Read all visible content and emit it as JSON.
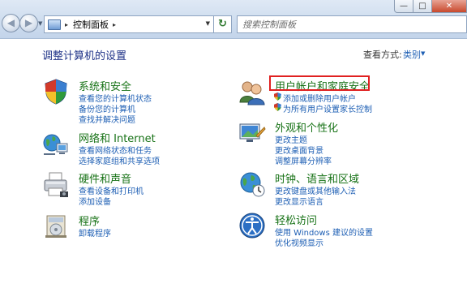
{
  "window": {
    "minimize_glyph": "—",
    "maximize_glyph": "□",
    "close_glyph": "✕"
  },
  "nav": {
    "back_glyph": "◀",
    "forward_glyph": "▶",
    "history_glyph": "▼"
  },
  "address": {
    "segments": [
      "控制面板"
    ],
    "separator": "▸",
    "refresh_glyph": "↻"
  },
  "search": {
    "placeholder": "搜索控制面板"
  },
  "header": {
    "title": "调整计算机的设置",
    "view_by_label": "查看方式:",
    "view_by_value": "类别"
  },
  "categories": {
    "system_security": {
      "icon": "shield-icon",
      "title": "系统和安全",
      "links": [
        "查看您的计算机状态",
        "备份您的计算机",
        "查找并解决问题"
      ]
    },
    "network": {
      "icon": "network-icon",
      "title": "网络和 Internet",
      "links": [
        "查看网络状态和任务",
        "选择家庭组和共享选项"
      ]
    },
    "hardware_sound": {
      "icon": "printer-icon",
      "title": "硬件和声音",
      "links": [
        "查看设备和打印机",
        "添加设备"
      ]
    },
    "programs": {
      "icon": "programs-icon",
      "title": "程序",
      "links": [
        "卸载程序"
      ]
    },
    "user_accounts": {
      "icon": "users-icon",
      "title": "用户帐户和家庭安全",
      "links": [
        "添加或删除用户帐户",
        "为所有用户设置家长控制"
      ]
    },
    "appearance": {
      "icon": "appearance-icon",
      "title": "外观和个性化",
      "links": [
        "更改主题",
        "更改桌面背景",
        "调整屏幕分辨率"
      ]
    },
    "clock_region": {
      "icon": "globe-icon",
      "title": "时钟、语言和区域",
      "links": [
        "更改键盘或其他输入法",
        "更改显示语言"
      ]
    },
    "ease_access": {
      "icon": "ease-of-access-icon",
      "title": "轻松访问",
      "links": [
        "使用 Windows 建议的设置",
        "优化视频显示"
      ]
    }
  },
  "colors": {
    "category_title": "#177216",
    "link": "#1e5fb4",
    "highlight": "#e02020"
  }
}
